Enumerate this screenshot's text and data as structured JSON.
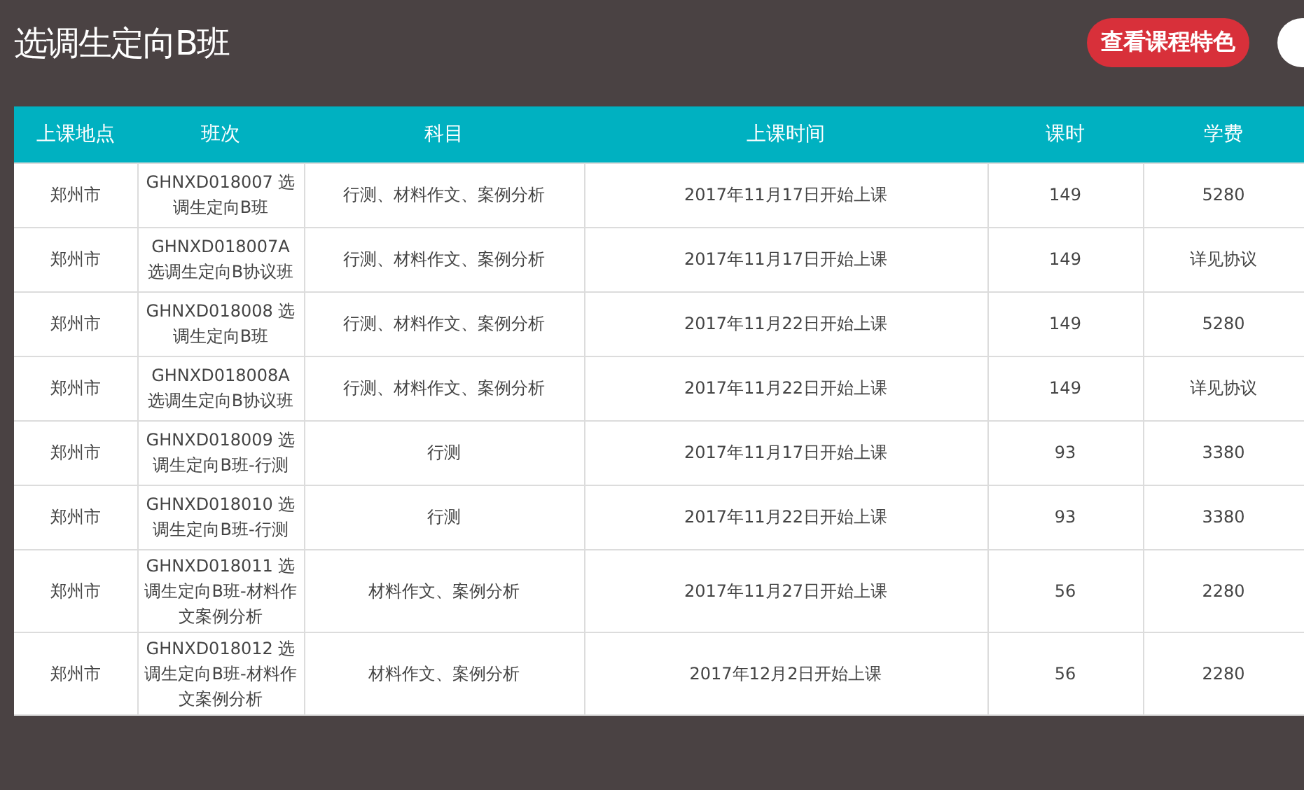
{
  "header": {
    "title": "选调生定向B班",
    "feature_button": "查看课程特色"
  },
  "table": {
    "columns": [
      "上课地点",
      "班次",
      "科目",
      "上课时间",
      "课时",
      "学费"
    ],
    "rows": [
      [
        "郑州市",
        "GHNXD018007 选调生定向B班",
        "行测、材料作文、案例分析",
        "2017年11月17日开始上课",
        "149",
        "5280"
      ],
      [
        "郑州市",
        "GHNXD018007A 选调生定向B协议班",
        "行测、材料作文、案例分析",
        "2017年11月17日开始上课",
        "149",
        "详见协议"
      ],
      [
        "郑州市",
        "GHNXD018008 选调生定向B班",
        "行测、材料作文、案例分析",
        "2017年11月22日开始上课",
        "149",
        "5280"
      ],
      [
        "郑州市",
        "GHNXD018008A 选调生定向B协议班",
        "行测、材料作文、案例分析",
        "2017年11月22日开始上课",
        "149",
        "详见协议"
      ],
      [
        "郑州市",
        "GHNXD018009 选调生定向B班-行测",
        "行测",
        "2017年11月17日开始上课",
        "93",
        "3380"
      ],
      [
        "郑州市",
        "GHNXD018010 选调生定向B班-行测",
        "行测",
        "2017年11月22日开始上课",
        "93",
        "3380"
      ],
      [
        "郑州市",
        "GHNXD018011 选调生定向B班-材料作文案例分析",
        "材料作文、案例分析",
        "2017年11月27日开始上课",
        "56",
        "2280"
      ],
      [
        "郑州市",
        "GHNXD018012 选调生定向B班-材料作文案例分析",
        "材料作文、案例分析",
        "2017年12月2日开始上课",
        "56",
        "2280"
      ]
    ]
  }
}
